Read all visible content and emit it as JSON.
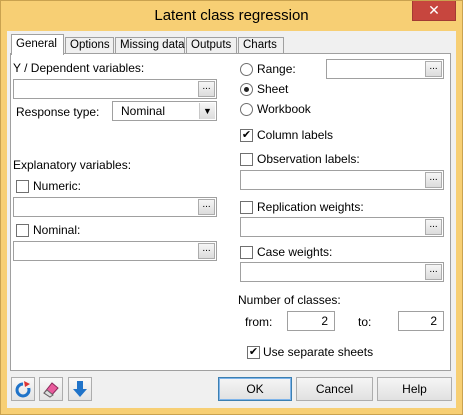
{
  "window": {
    "title": "Latent class regression",
    "close_glyph": "✕"
  },
  "tabs": [
    {
      "label": "General"
    },
    {
      "label": "Options"
    },
    {
      "label": "Missing data"
    },
    {
      "label": "Outputs"
    },
    {
      "label": "Charts"
    }
  ],
  "general": {
    "dependent_label": "Y / Dependent variables:",
    "dependent_value": "",
    "response_type_label": "Response type:",
    "response_type_value": "Nominal",
    "explanatory_label": "Explanatory variables:",
    "numeric_label": "Numeric:",
    "numeric_checked": false,
    "numeric_value": "",
    "nominal_label": "Nominal:",
    "nominal_checked": false,
    "nominal_value": "",
    "range_label": "Range:",
    "range_value": "",
    "sheet_label": "Sheet",
    "workbook_label": "Workbook",
    "output_selected": "Sheet",
    "column_labels_label": "Column labels",
    "column_labels_checked": true,
    "observation_labels_label": "Observation labels:",
    "observation_labels_checked": false,
    "replication_weights_label": "Replication weights:",
    "replication_weights_checked": false,
    "case_weights_label": "Case weights:",
    "case_weights_checked": false,
    "num_classes_label": "Number of classes:",
    "from_label": "from:",
    "from_value": "2",
    "to_label": "to:",
    "to_value": "2",
    "separate_sheets_label": "Use separate sheets",
    "separate_sheets_checked": true
  },
  "footer": {
    "ok_label": "OK",
    "cancel_label": "Cancel",
    "help_label": "Help",
    "ellipsis_glyph": "..."
  },
  "icons": {
    "reset": "reset-icon",
    "eraser": "eraser-icon",
    "down": "down-arrow-icon"
  },
  "colors": {
    "frame": "#f7cf74",
    "close": "#c7463e",
    "accent_blue": "#1f73c9"
  }
}
